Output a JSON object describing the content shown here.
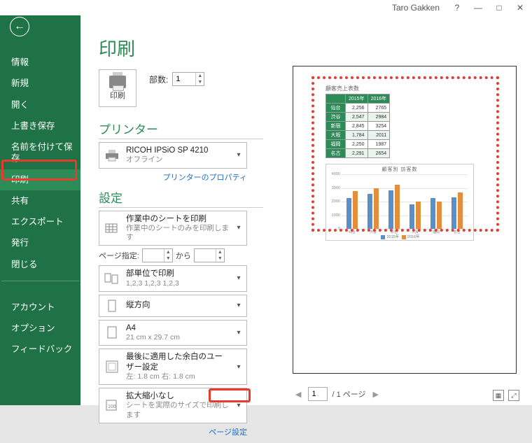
{
  "titlebar": {
    "user": "Taro Gakken"
  },
  "sidebar": {
    "items": [
      {
        "label": "情報"
      },
      {
        "label": "新規"
      },
      {
        "label": "開く"
      },
      {
        "label": "上書き保存"
      },
      {
        "label": "名前を付けて保存"
      },
      {
        "label": "印刷"
      },
      {
        "label": "共有"
      },
      {
        "label": "エクスポート"
      },
      {
        "label": "発行"
      },
      {
        "label": "閉じる"
      },
      {
        "label": "アカウント"
      },
      {
        "label": "オプション"
      },
      {
        "label": "フィードバック"
      }
    ]
  },
  "title": "印刷",
  "copies": {
    "label": "部数:",
    "value": "1"
  },
  "print_button": {
    "label": "印刷"
  },
  "printer_section": {
    "title": "プリンター",
    "name": "RICOH IPSiO SP 4210",
    "status": "オフライン",
    "properties_link": "プリンターのプロパティ"
  },
  "settings_section": {
    "title": "設定",
    "active_sheets": {
      "main": "作業中のシートを印刷",
      "sub": "作業中のシートのみを印刷します"
    },
    "page_range": {
      "label": "ページ指定:",
      "from": "",
      "to_label": "から",
      "to": ""
    },
    "collate": {
      "main": "部単位で印刷",
      "sub": "1,2,3   1,2,3   1,2,3"
    },
    "orientation": {
      "main": "縦方向"
    },
    "paper": {
      "main": "A4",
      "sub": "21 cm x 29.7 cm"
    },
    "margins": {
      "main": "最後に適用した余白のユーザー設定",
      "sub": "左: 1.8 cm   右: 1.8 cm"
    },
    "scaling": {
      "main": "拡大縮小なし",
      "sub": "シートを実際のサイズで印刷します"
    },
    "page_setup_link": "ページ設定"
  },
  "preview": {
    "table_title": "顧客売上表数",
    "table": {
      "headers": [
        "",
        "2015年",
        "2016年"
      ],
      "rows": [
        [
          "仙台",
          "2,256",
          "2765"
        ],
        [
          "渋谷",
          "2,547",
          "2984"
        ],
        [
          "新宿",
          "2,845",
          "3254"
        ],
        [
          "大阪",
          "1,784",
          "2011"
        ],
        [
          "福岡",
          "2,250",
          "1987"
        ],
        [
          "名古",
          "2,291",
          "2654"
        ]
      ]
    },
    "chart_title": "顧客別 訪客数",
    "legend": {
      "a": "2015年",
      "b": "2016年"
    }
  },
  "chart_data": {
    "type": "bar",
    "title": "顧客別 訪客数",
    "categories": [
      "仙台",
      "渋谷",
      "新宿",
      "大阪",
      "福岡",
      "名古"
    ],
    "series": [
      {
        "name": "2015年",
        "values": [
          2256,
          2547,
          2845,
          1784,
          2250,
          2291
        ]
      },
      {
        "name": "2016年",
        "values": [
          2765,
          2984,
          3254,
          2011,
          1987,
          2654
        ]
      }
    ],
    "ylim": [
      0,
      4000
    ],
    "yticks": [
      0,
      1000,
      2000,
      3000,
      4000
    ],
    "xlabel": "",
    "ylabel": ""
  },
  "nav": {
    "page": "1",
    "total_label": "/ 1 ページ"
  }
}
